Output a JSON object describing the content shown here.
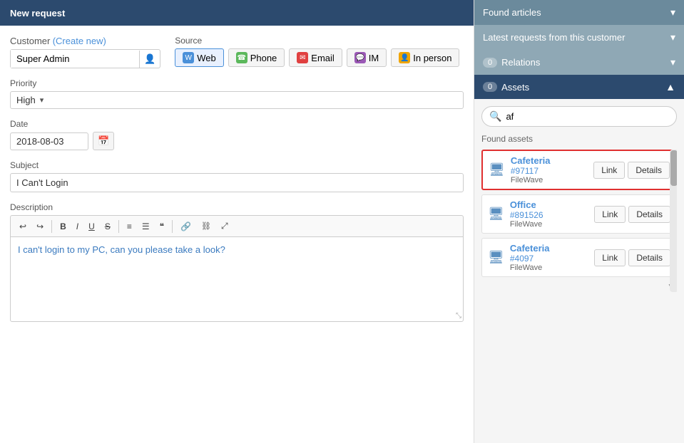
{
  "header": {
    "title": "New request"
  },
  "form": {
    "customer_label": "Customer",
    "customer_create_new": "(Create new)",
    "customer_value": "Super Admin",
    "source_label": "Source",
    "source_options": [
      {
        "id": "web",
        "label": "Web",
        "icon_class": "icon-web",
        "icon_char": "W",
        "active": true
      },
      {
        "id": "phone",
        "label": "Phone",
        "icon_class": "icon-phone",
        "icon_char": "☎"
      },
      {
        "id": "email",
        "label": "Email",
        "icon_class": "icon-email",
        "icon_char": "✉"
      },
      {
        "id": "im",
        "label": "IM",
        "icon_class": "icon-im",
        "icon_char": "💬"
      },
      {
        "id": "inperson",
        "label": "In person",
        "icon_class": "icon-inperson",
        "icon_char": "👤"
      }
    ],
    "priority_label": "Priority",
    "priority_value": "High",
    "date_label": "Date",
    "date_value": "2018-08-03",
    "subject_label": "Subject",
    "subject_value": "I Can't Login",
    "description_label": "Description",
    "editor_content": "I can't login to my PC, can you please take a look?"
  },
  "toolbar": {
    "undo": "↩",
    "redo": "↪",
    "bold": "B",
    "italic": "I",
    "underline": "U",
    "strikethrough": "S",
    "ordered_list": "ol",
    "unordered_list": "ul",
    "blockquote": "❝",
    "link": "🔗",
    "unlink": "🚫",
    "fullscreen": "⤢"
  },
  "right_panel": {
    "found_articles": {
      "title": "Found articles",
      "collapsed": true
    },
    "latest_requests": {
      "title": "Latest requests from this customer",
      "collapsed": true
    },
    "relations": {
      "title": "Relations",
      "count": "0",
      "collapsed": true
    },
    "assets": {
      "title": "Assets",
      "count": "0",
      "search_placeholder": "af",
      "search_value": "af",
      "found_label": "Found assets",
      "items": [
        {
          "id": "asset-1",
          "name": "Cafeteria",
          "number": "#97117",
          "type": "FileWave",
          "highlighted": true
        },
        {
          "id": "asset-2",
          "name": "Office",
          "number": "#891526",
          "type": "FileWave",
          "highlighted": false
        },
        {
          "id": "asset-3",
          "name": "Cafeteria",
          "number": "#4097",
          "type": "FileWave",
          "highlighted": false
        }
      ],
      "link_label": "Link",
      "details_label": "Details"
    }
  }
}
